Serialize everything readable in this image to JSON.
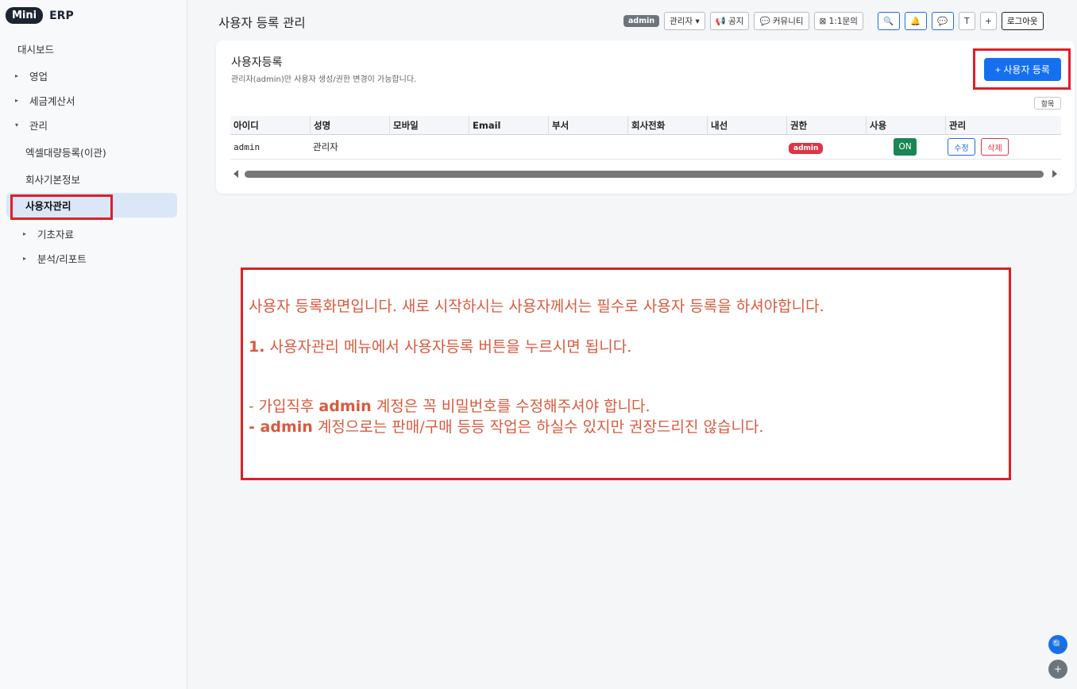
{
  "brand": {
    "pill": "Mini",
    "text": "ERP"
  },
  "sidebar": {
    "items": [
      {
        "label": "대시보드",
        "caret": ""
      },
      {
        "label": "영업",
        "caret": "▸"
      },
      {
        "label": "세금계산서",
        "caret": "▸"
      },
      {
        "label": "관리",
        "caret": "▾"
      },
      {
        "label": "엑셀대량등록(이관)",
        "caret": ""
      },
      {
        "label": "회사기본정보",
        "caret": ""
      },
      {
        "label": "사용자관리",
        "caret": ""
      },
      {
        "label": "기초자료",
        "caret": "▸"
      },
      {
        "label": "분석/리포트",
        "caret": "▸"
      }
    ]
  },
  "header": {
    "title": "사용자 등록 관리",
    "badge": "admin",
    "role_select": "관리자 ▾",
    "notice": "📢 공지",
    "community": "💬 커뮤니티",
    "inquiry": "⊠ 1:1문의",
    "search_icon": "🔍",
    "bell_icon": "🔔",
    "chat_icon": "💬",
    "t_btn": "T",
    "plus_btn": "+",
    "logout": "로그아웃"
  },
  "card": {
    "title": "사용자등록",
    "subtitle": "관리자(admin)만 사용자 생성/권한 변경이 가능합니다.",
    "add_button": "+ 사용자 등록",
    "columns_button": "항목",
    "columns": [
      "아이디",
      "성명",
      "모바일",
      "Email",
      "부서",
      "회사전화",
      "내선",
      "권한",
      "사용",
      "관리"
    ],
    "rows": [
      {
        "id": "admin",
        "name": "관리자",
        "mobile": "",
        "email": "",
        "dept": "",
        "phone": "",
        "ext": "",
        "role": "admin",
        "use": "ON",
        "edit": "수정",
        "delete": "삭제"
      }
    ]
  },
  "note": {
    "line1": "사용자 등록화면입니다. 새로 시작하시는 사용자께서는 필수로 사용자 등록을 하셔야합니다.",
    "line2_num": "1.",
    "line2": " 사용자관리 메뉴에서 사용자등록 버튼을 누르시면 됩니다.",
    "line3_pre": "- 가입직후 ",
    "line3_bold": "admin",
    "line3_post": " 계정은 꼭 비밀번호를 수정해주셔야 합니다.",
    "line4_pre": "- ",
    "line4_bold": "admin",
    "line4_post": " 계정으로는 판매/구매 등등 작업은 하실수 있지만 권장드리진 않습니다."
  },
  "fab": {
    "search": "🔍",
    "plus": "+"
  },
  "colors": {
    "accent": "#1570ef",
    "highlight": "#e01e28",
    "note_text": "#d95a3e",
    "success": "#198754",
    "danger": "#dc3545"
  }
}
